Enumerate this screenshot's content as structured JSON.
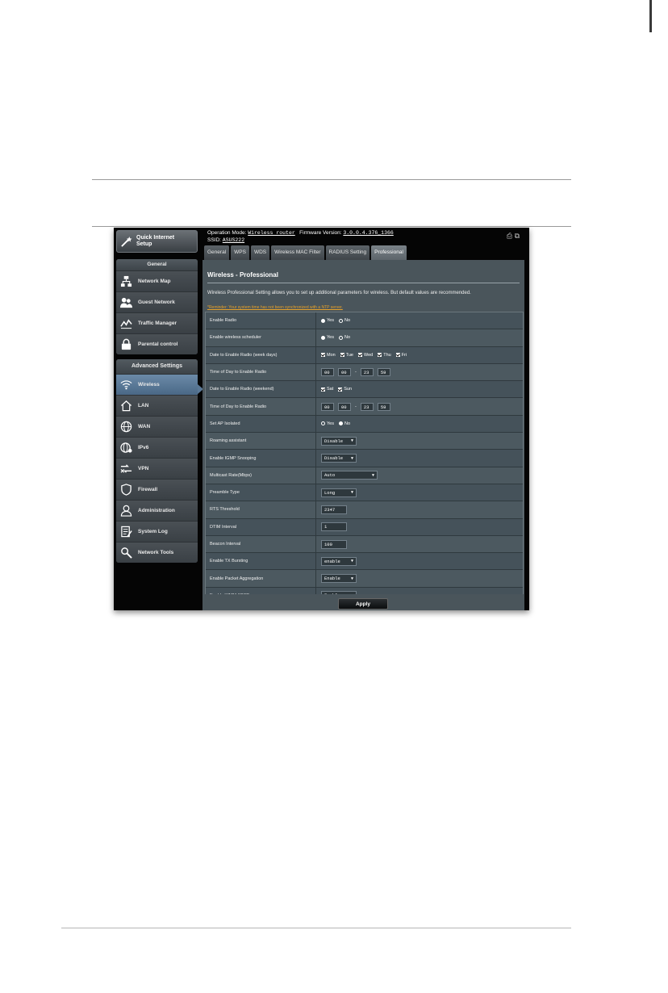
{
  "header": {
    "operation_mode_label": "Operation Mode:",
    "operation_mode_value": "Wireless router",
    "firmware_label": "Firmware Version:",
    "firmware_value": "3.0.0.4.376_1366",
    "ssid_label": "SSID:",
    "ssid_value": "ASUS222"
  },
  "sidebar": {
    "quick_setup_label": "Quick Internet\nSetup",
    "general_title": "General",
    "general_items": [
      {
        "label": "Network Map",
        "icon": "network-map-icon"
      },
      {
        "label": "Guest Network",
        "icon": "guest-network-icon"
      },
      {
        "label": "Traffic Manager",
        "icon": "traffic-manager-icon"
      },
      {
        "label": "Parental control",
        "icon": "lock-icon"
      }
    ],
    "advanced_title": "Advanced Settings",
    "advanced_items": [
      {
        "label": "Wireless",
        "icon": "wifi-icon",
        "active": true
      },
      {
        "label": "LAN",
        "icon": "home-icon"
      },
      {
        "label": "WAN",
        "icon": "globe-icon"
      },
      {
        "label": "IPv6",
        "icon": "ipv6-icon"
      },
      {
        "label": "VPN",
        "icon": "vpn-icon"
      },
      {
        "label": "Firewall",
        "icon": "shield-icon"
      },
      {
        "label": "Administration",
        "icon": "user-icon"
      },
      {
        "label": "System Log",
        "icon": "log-icon"
      },
      {
        "label": "Network Tools",
        "icon": "tools-icon"
      }
    ]
  },
  "tabs": [
    "General",
    "WPS",
    "WDS",
    "Wireless MAC Filter",
    "RADIUS Setting",
    "Professional"
  ],
  "active_tab": 5,
  "panel": {
    "title": "Wireless - Professional",
    "description": "Wireless Professional Setting allows you to set up additional parameters for wireless. But default values are recommended.",
    "reminder": "*Reminder: Your system time has not been synchronized with a NTP server.",
    "apply_label": "Apply"
  },
  "radio": {
    "yes": "Yes",
    "no": "No"
  },
  "weekdays": [
    "Mon",
    "Tue",
    "Wed",
    "Thu",
    "Fri"
  ],
  "weekend": [
    "Sat",
    "Sun"
  ],
  "time_weekday": [
    "00",
    "00",
    "23",
    "59"
  ],
  "time_weekend": [
    "00",
    "00",
    "23",
    "59"
  ],
  "rows": [
    {
      "label": "Enable Radio",
      "type": "radio",
      "value": "yes"
    },
    {
      "label": "Enable wireless scheduler",
      "type": "radio",
      "value": "yes"
    },
    {
      "label": "Date to Enable Radio (week days)",
      "type": "weekdays"
    },
    {
      "label": "Time of Day to Enable Radio",
      "type": "time_weekday"
    },
    {
      "label": "Date to Enable Radio (weekend)",
      "type": "weekend"
    },
    {
      "label": "Time of Day to Enable Radio",
      "type": "time_weekend"
    },
    {
      "label": "Set AP Isolated",
      "type": "radio",
      "value": "no"
    },
    {
      "label": "Roaming assistant",
      "type": "select",
      "value": "Disable"
    },
    {
      "label": "Enable IGMP Snooping",
      "type": "select",
      "value": "Disable"
    },
    {
      "label": "Multicast Rate(Mbps)",
      "type": "select",
      "value": "Auto",
      "wide": true
    },
    {
      "label": "Preamble Type",
      "type": "select",
      "value": "Long"
    },
    {
      "label": "RTS Threshold",
      "type": "input",
      "value": "2347"
    },
    {
      "label": "DTIM Interval",
      "type": "input",
      "value": "1"
    },
    {
      "label": "Beacon Interval",
      "type": "input",
      "value": "100"
    },
    {
      "label": "Enable TX Bursting",
      "type": "select",
      "value": "enable"
    },
    {
      "label": "Enable Packet Aggregation",
      "type": "select",
      "value": "Enable"
    },
    {
      "label": "Enable WMM APSD",
      "type": "select",
      "value": "Enable"
    }
  ]
}
